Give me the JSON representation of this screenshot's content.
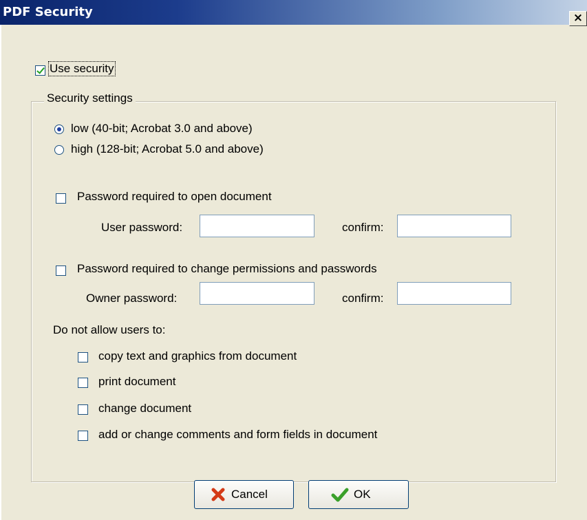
{
  "window": {
    "title": "PDF Security",
    "close_glyph": "×"
  },
  "use_security": {
    "label": "Use security",
    "checked": true
  },
  "security_settings": {
    "legend": "Security settings",
    "encryption": [
      {
        "label": "low (40-bit; Acrobat 3.0 and above)",
        "selected": true
      },
      {
        "label": "high (128-bit; Acrobat 5.0 and above)",
        "selected": false
      }
    ],
    "open_password": {
      "label": "Password required to open document",
      "checked": false,
      "password_label": "User password:",
      "password_value": "",
      "confirm_label": "confirm:",
      "confirm_value": ""
    },
    "permissions_password": {
      "label": "Password required to change permissions and passwords",
      "checked": false,
      "password_label": "Owner password:",
      "password_value": "",
      "confirm_label": "confirm:",
      "confirm_value": ""
    },
    "restrictions": {
      "label": "Do not allow users to:",
      "items": [
        {
          "label": "copy text and graphics from document",
          "checked": false
        },
        {
          "label": "print document",
          "checked": false
        },
        {
          "label": "change document",
          "checked": false
        },
        {
          "label": "add or change comments and form fields in document",
          "checked": false
        }
      ]
    }
  },
  "buttons": {
    "cancel": {
      "label": "Cancel",
      "icon": "red-x-icon"
    },
    "ok": {
      "label": "OK",
      "icon": "green-check-icon"
    }
  },
  "colors": {
    "titlebar": "#0a246a",
    "dialog_bg": "#ece9d8",
    "cancel_icon": "#d43a16",
    "ok_icon": "#3aa02a"
  }
}
